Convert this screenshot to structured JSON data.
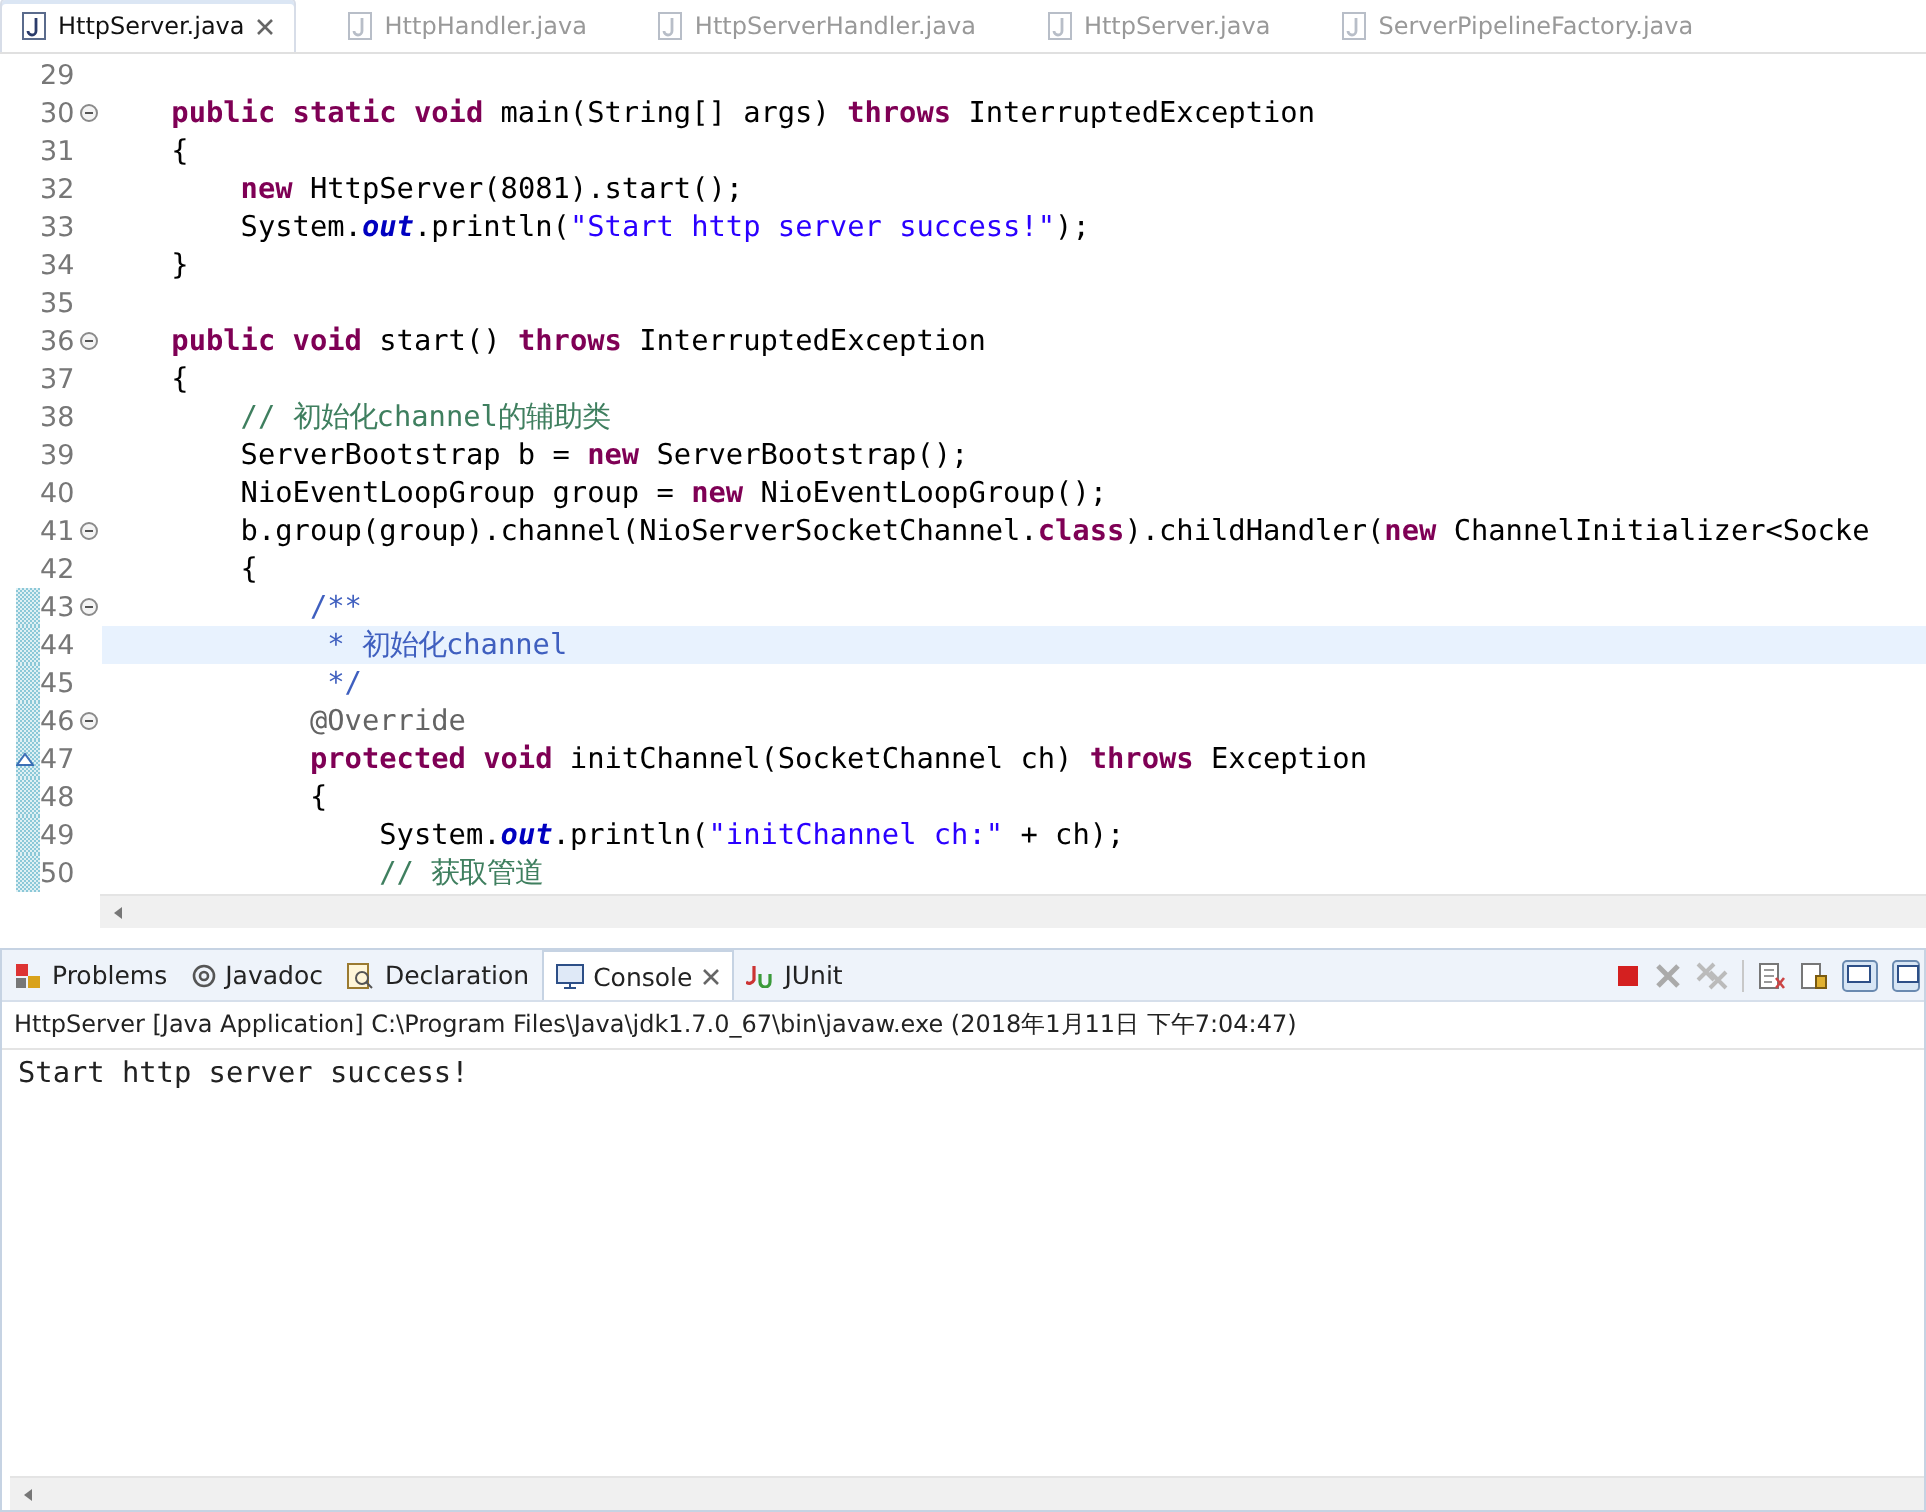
{
  "editor": {
    "tabs": [
      {
        "label": "HttpServer.java",
        "selected": true
      },
      {
        "label": "HttpHandler.java",
        "selected": false
      },
      {
        "label": "HttpServerHandler.java",
        "selected": false
      },
      {
        "label": "HttpServer.java",
        "selected": false
      },
      {
        "label": "ServerPipelineFactory.java",
        "selected": false
      }
    ],
    "lines": [
      {
        "number": "29",
        "fold": false,
        "current": false,
        "changed": false,
        "override": false
      },
      {
        "number": "30",
        "fold": true,
        "current": false,
        "changed": false,
        "override": false,
        "tokens": [
          {
            "kind": "keyword",
            "text": "    public static void"
          },
          {
            "kind": "plain",
            "text": " main(String[] args) "
          },
          {
            "kind": "keyword",
            "text": "throws"
          },
          {
            "kind": "plain",
            "text": " InterruptedException"
          }
        ]
      },
      {
        "number": "31",
        "fold": false,
        "current": false,
        "changed": false,
        "override": false,
        "tokens": [
          {
            "kind": "plain",
            "text": "    {"
          }
        ]
      },
      {
        "number": "32",
        "fold": false,
        "current": false,
        "changed": false,
        "override": false,
        "tokens": [
          {
            "kind": "keyword",
            "text": "        new"
          },
          {
            "kind": "plain",
            "text": " HttpServer(8081).start();"
          }
        ]
      },
      {
        "number": "33",
        "fold": false,
        "current": false,
        "changed": false,
        "override": false,
        "tokens": [
          {
            "kind": "plain",
            "text": "        System."
          },
          {
            "kind": "field",
            "text": "out"
          },
          {
            "kind": "plain",
            "text": ".println("
          },
          {
            "kind": "string",
            "text": "\"Start http server success!\""
          },
          {
            "kind": "plain",
            "text": ");"
          }
        ]
      },
      {
        "number": "34",
        "fold": false,
        "current": false,
        "changed": false,
        "override": false,
        "tokens": [
          {
            "kind": "plain",
            "text": "    }"
          }
        ]
      },
      {
        "number": "35",
        "fold": false,
        "current": false,
        "changed": false,
        "override": false
      },
      {
        "number": "36",
        "fold": true,
        "current": false,
        "changed": false,
        "override": false,
        "tokens": [
          {
            "kind": "keyword",
            "text": "    public void"
          },
          {
            "kind": "plain",
            "text": " start() "
          },
          {
            "kind": "keyword",
            "text": "throws"
          },
          {
            "kind": "plain",
            "text": " InterruptedException"
          }
        ]
      },
      {
        "number": "37",
        "fold": false,
        "current": false,
        "changed": false,
        "override": false,
        "tokens": [
          {
            "kind": "plain",
            "text": "    {"
          }
        ]
      },
      {
        "number": "38",
        "fold": false,
        "current": false,
        "changed": false,
        "override": false,
        "tokens": [
          {
            "kind": "comment",
            "text": "        // 初始化channel的辅助类"
          }
        ]
      },
      {
        "number": "39",
        "fold": false,
        "current": false,
        "changed": false,
        "override": false,
        "tokens": [
          {
            "kind": "plain",
            "text": "        ServerBootstrap b = "
          },
          {
            "kind": "keyword",
            "text": "new"
          },
          {
            "kind": "plain",
            "text": " ServerBootstrap();"
          }
        ]
      },
      {
        "number": "40",
        "fold": false,
        "current": false,
        "changed": false,
        "override": false,
        "tokens": [
          {
            "kind": "plain",
            "text": "        NioEventLoopGroup group = "
          },
          {
            "kind": "keyword",
            "text": "new"
          },
          {
            "kind": "plain",
            "text": " NioEventLoopGroup();"
          }
        ]
      },
      {
        "number": "41",
        "fold": true,
        "current": false,
        "changed": false,
        "override": false,
        "tokens": [
          {
            "kind": "plain",
            "text": "        b.group(group).channel(NioServerSocketChannel."
          },
          {
            "kind": "keyword",
            "text": "class"
          },
          {
            "kind": "plain",
            "text": ").childHandler("
          },
          {
            "kind": "keyword",
            "text": "new"
          },
          {
            "kind": "plain",
            "text": " ChannelInitializer<Socke"
          }
        ]
      },
      {
        "number": "42",
        "fold": false,
        "current": false,
        "changed": false,
        "override": false,
        "tokens": [
          {
            "kind": "plain",
            "text": "        {"
          }
        ]
      },
      {
        "number": "43",
        "fold": true,
        "current": false,
        "changed": true,
        "override": false,
        "tokens": [
          {
            "kind": "javadoc",
            "text": "            /**"
          }
        ]
      },
      {
        "number": "44",
        "fold": false,
        "current": true,
        "changed": true,
        "override": false,
        "tokens": [
          {
            "kind": "javadoc",
            "text": "             * 初始化channel"
          }
        ]
      },
      {
        "number": "45",
        "fold": false,
        "current": false,
        "changed": true,
        "override": false,
        "tokens": [
          {
            "kind": "javadoc",
            "text": "             */"
          }
        ]
      },
      {
        "number": "46",
        "fold": true,
        "current": false,
        "changed": true,
        "override": false,
        "tokens": [
          {
            "kind": "annotation",
            "text": "            @Override"
          }
        ]
      },
      {
        "number": "47",
        "fold": false,
        "current": false,
        "changed": true,
        "override": true,
        "tokens": [
          {
            "kind": "keyword",
            "text": "            protected void"
          },
          {
            "kind": "plain",
            "text": " initChannel(SocketChannel ch) "
          },
          {
            "kind": "keyword",
            "text": "throws"
          },
          {
            "kind": "plain",
            "text": " Exception"
          }
        ]
      },
      {
        "number": "48",
        "fold": false,
        "current": false,
        "changed": true,
        "override": false,
        "tokens": [
          {
            "kind": "plain",
            "text": "            {"
          }
        ]
      },
      {
        "number": "49",
        "fold": false,
        "current": false,
        "changed": true,
        "override": false,
        "tokens": [
          {
            "kind": "plain",
            "text": "                System."
          },
          {
            "kind": "field",
            "text": "out"
          },
          {
            "kind": "plain",
            "text": ".println("
          },
          {
            "kind": "string",
            "text": "\"initChannel ch:\""
          },
          {
            "kind": "plain",
            "text": " + ch);"
          }
        ]
      },
      {
        "number": "50",
        "fold": false,
        "current": false,
        "changed": true,
        "override": false,
        "tokens": [
          {
            "kind": "comment",
            "text": "                // 获取管道"
          }
        ]
      }
    ]
  },
  "console": {
    "tabs": [
      {
        "label": "Problems",
        "kind": "problems",
        "selected": false
      },
      {
        "label": "Javadoc",
        "kind": "javadoc",
        "selected": false
      },
      {
        "label": "Declaration",
        "kind": "declaration",
        "selected": false
      },
      {
        "label": "Console",
        "kind": "console",
        "selected": true
      },
      {
        "label": "JUnit",
        "kind": "junit",
        "selected": false
      }
    ],
    "description": "HttpServer [Java Application] C:\\Program Files\\Java\\jdk1.7.0_67\\bin\\javaw.exe (2018年1月11日 下午7:04:47)",
    "output": [
      "Start http server success!"
    ]
  }
}
